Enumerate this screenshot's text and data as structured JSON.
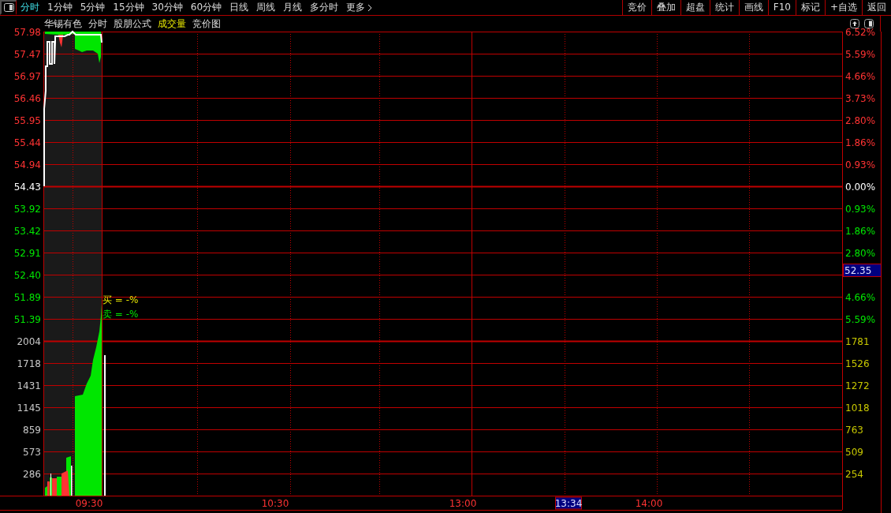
{
  "toolbar": {
    "tabs": [
      {
        "label": "分时",
        "selected": true
      },
      {
        "label": "1分钟",
        "selected": false
      },
      {
        "label": "5分钟",
        "selected": false
      },
      {
        "label": "15分钟",
        "selected": false
      },
      {
        "label": "30分钟",
        "selected": false
      },
      {
        "label": "60分钟",
        "selected": false
      },
      {
        "label": "日线",
        "selected": false
      },
      {
        "label": "周线",
        "selected": false
      },
      {
        "label": "月线",
        "selected": false
      },
      {
        "label": "多分时",
        "selected": false
      }
    ],
    "more": "更多",
    "buttons": [
      "竞价",
      "叠加",
      "超盘",
      "统计",
      "画线",
      "F10",
      "标记",
      "+自选",
      "返回"
    ]
  },
  "header": {
    "items": [
      {
        "label": "华锡有色",
        "highlighted": false
      },
      {
        "label": "分时",
        "highlighted": false
      },
      {
        "label": "股朋公式",
        "highlighted": false
      },
      {
        "label": "成交量",
        "highlighted": true
      },
      {
        "label": "竞价图",
        "highlighted": false
      }
    ]
  },
  "chart": {
    "left_price_labels": [
      {
        "label": "57.98",
        "color": "#ff3333"
      },
      {
        "label": "57.47",
        "color": "#ff3333"
      },
      {
        "label": "56.97",
        "color": "#ff3333"
      },
      {
        "label": "56.46",
        "color": "#ff3333"
      },
      {
        "label": "55.95",
        "color": "#ff3333"
      },
      {
        "label": "55.44",
        "color": "#ff3333"
      },
      {
        "label": "54.94",
        "color": "#ff3333"
      },
      {
        "label": "54.43",
        "color": "#ffffff"
      },
      {
        "label": "53.92",
        "color": "#00e600"
      },
      {
        "label": "53.42",
        "color": "#00e600"
      },
      {
        "label": "52.91",
        "color": "#00e600"
      },
      {
        "label": "52.40",
        "color": "#00e600"
      },
      {
        "label": "51.89",
        "color": "#00e600"
      },
      {
        "label": "51.39",
        "color": "#00e600"
      }
    ],
    "right_price_labels": [
      {
        "label": "6.52%",
        "kind": "value",
        "color": "#ff3333"
      },
      {
        "label": "5.59%",
        "kind": "value",
        "color": "#ff3333"
      },
      {
        "label": "4.66%",
        "kind": "value",
        "color": "#ff3333"
      },
      {
        "label": "3.73%",
        "kind": "value",
        "color": "#ff3333"
      },
      {
        "label": "2.80%",
        "kind": "value",
        "color": "#ff3333"
      },
      {
        "label": "1.86%",
        "kind": "value",
        "color": "#ff3333"
      },
      {
        "label": "0.93%",
        "kind": "value",
        "color": "#ff3333"
      },
      {
        "label": "0.00%",
        "kind": "value",
        "color": "#ffffff"
      },
      {
        "label": "0.93%",
        "kind": "value",
        "color": "#00e600"
      },
      {
        "label": "1.86%",
        "kind": "value",
        "color": "#00e600"
      },
      {
        "label": "2.80%",
        "kind": "value",
        "color": "#00e600"
      },
      {
        "label": "52.35",
        "kind": "cursor"
      },
      {
        "label": "4.66%",
        "kind": "value",
        "color": "#00e600"
      },
      {
        "label": "5.59%",
        "kind": "value",
        "color": "#00e600"
      }
    ],
    "left_volume_labels": [
      "2004",
      "1718",
      "1431",
      "1145",
      "859",
      "573",
      "286"
    ],
    "right_volume_labels": [
      "1781",
      "1526",
      "1272",
      "1018",
      "763",
      "509",
      "254"
    ],
    "buy_label": "买 = -%",
    "sell_label": "卖 = -%",
    "time_labels": [
      {
        "label": "09:30",
        "kind": "tick"
      },
      {
        "label": "10:30",
        "kind": "tick"
      },
      {
        "label": "13:00",
        "kind": "tick"
      },
      {
        "label": "13:34",
        "kind": "cursor"
      },
      {
        "label": "14:00",
        "kind": "tick"
      }
    ]
  }
}
